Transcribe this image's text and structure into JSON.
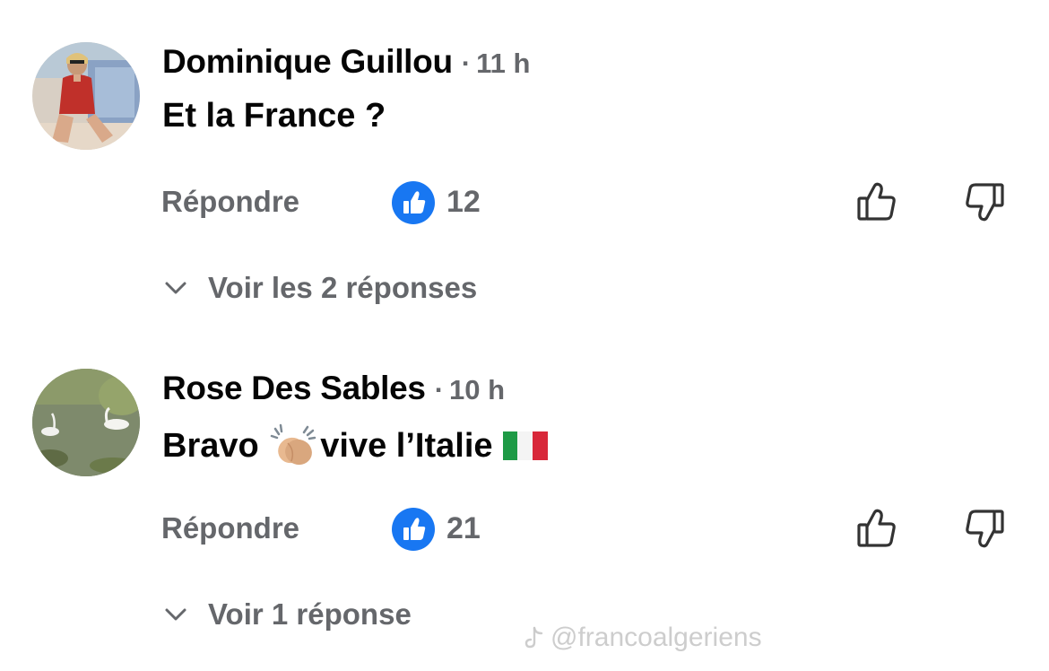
{
  "comments": [
    {
      "author": "Dominique Guillou",
      "time": "11 h",
      "text": "Et la France ?",
      "reply_label": "Répondre",
      "like_count": "12",
      "replies_label": "Voir les 2 réponses"
    },
    {
      "author": "Rose Des Sables",
      "time": "10 h",
      "text_before": "Bravo ",
      "text_after": "vive l’Italie ",
      "reply_label": "Répondre",
      "like_count": "21",
      "replies_label": "Voir 1 réponse"
    }
  ],
  "watermark": {
    "text": "@francoalgeriens"
  },
  "colors": {
    "text": "#050505",
    "secondary": "#65676b",
    "like_blue": "#1877f2"
  },
  "icons": [
    "like-badge-icon",
    "thumbs-up-icon",
    "thumbs-down-icon",
    "chevron-down-icon",
    "clapping-hands-emoji",
    "italy-flag-emoji",
    "tiktok-icon"
  ]
}
